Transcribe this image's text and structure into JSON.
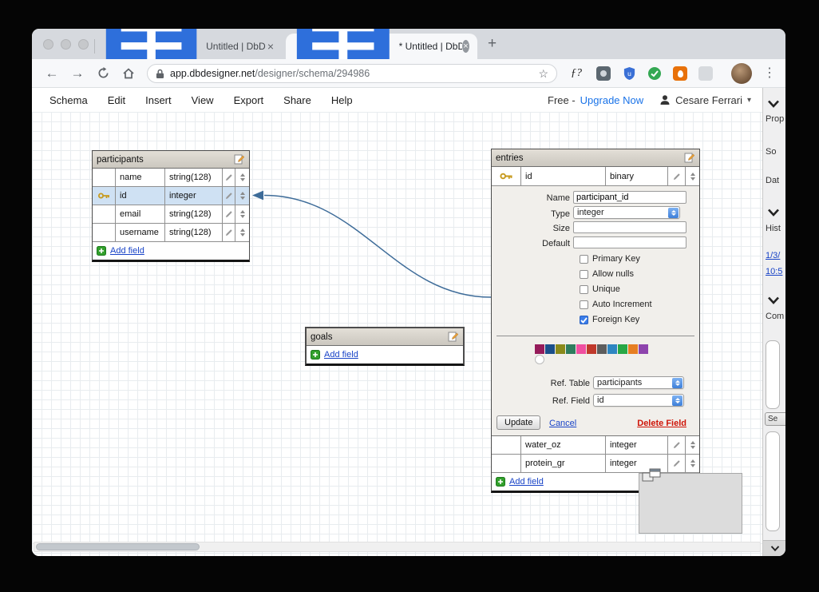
{
  "browser": {
    "tab1": {
      "title": "Untitled | DbDesigner.net"
    },
    "tab2": {
      "title": "* Untitled | DbDesigner.net"
    },
    "address": {
      "domain": "app.dbdesigner.net",
      "path": "/designer/schema/294986"
    },
    "ext_f": "ƒ?",
    "ext_ublock": "u"
  },
  "menubar": {
    "items": [
      "Schema",
      "Edit",
      "Insert",
      "View",
      "Export",
      "Share",
      "Help"
    ],
    "plan_prefix": "Free - ",
    "upgrade": "Upgrade Now",
    "user": "Cesare Ferrari"
  },
  "participants": {
    "title": "participants",
    "fields": [
      {
        "name": "name",
        "type": "string(128)"
      },
      {
        "name": "id",
        "type": "integer",
        "key": true,
        "highlighted": true
      },
      {
        "name": "email",
        "type": "string(128)"
      },
      {
        "name": "username",
        "type": "string(128)"
      }
    ],
    "add_field": "Add field"
  },
  "entries": {
    "title": "entries",
    "field_top": {
      "name": "id",
      "type": "binary",
      "key": true
    },
    "editor": {
      "labels": {
        "name": "Name",
        "type": "Type",
        "size": "Size",
        "default": "Default",
        "ref_table": "Ref. Table",
        "ref_field": "Ref. Field"
      },
      "values": {
        "name": "participant_id",
        "type": "integer",
        "size": "",
        "default": "",
        "ref_table": "participants",
        "ref_field": "id"
      },
      "checkboxes": [
        {
          "label": "Primary Key",
          "checked": false
        },
        {
          "label": "Allow nulls",
          "checked": false
        },
        {
          "label": "Unique",
          "checked": false
        },
        {
          "label": "Auto Increment",
          "checked": false
        },
        {
          "label": "Foreign Key",
          "checked": true
        }
      ],
      "swatches": [
        "#951b5a",
        "#1b4f8a",
        "#8a8a1b",
        "#2e7d5e",
        "#f04fa0",
        "#c0392b",
        "#5d5d5d",
        "#2e86c1",
        "#28a745",
        "#e67e22",
        "#8e44ad",
        "#ffffff"
      ],
      "buttons": {
        "update": "Update",
        "cancel": "Cancel",
        "delete": "Delete Field"
      }
    },
    "fields_bottom": [
      {
        "name": "water_oz",
        "type": "integer"
      },
      {
        "name": "protein_gr",
        "type": "integer"
      }
    ],
    "add_field": "Add field"
  },
  "goals": {
    "title": "goals",
    "add_field": "Add field"
  },
  "sidebar": {
    "section_properties": "Prop",
    "label_so": "So",
    "label_dat": "Dat",
    "section_history": "Hist",
    "link_date": "1/3/",
    "link_time": "10:5",
    "section_comments": "Com",
    "button_se": "Se"
  },
  "theme": {
    "link_blue": "#1843c7",
    "upgrade_blue": "#1a73e8",
    "delete_red": "#cf1508",
    "row_highlight": "#cfe1f3",
    "connector": "#3e6c99"
  }
}
